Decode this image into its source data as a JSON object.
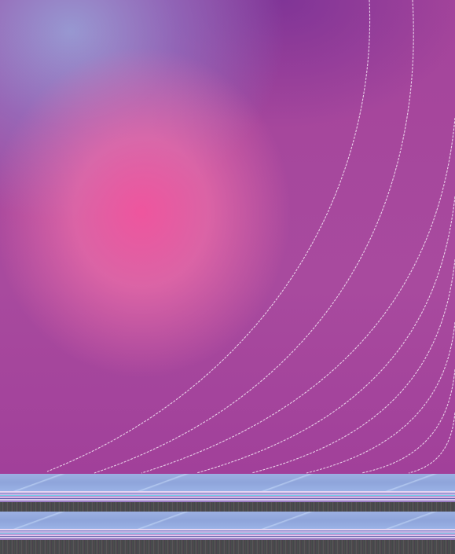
{
  "screen": {
    "kind": "desktop-wallpaper",
    "palette": {
      "base": "#a6449a",
      "glow_pink": "#f2569e",
      "glow_lavender": "#96a0d7",
      "deep_purple": "#7a3296",
      "arc_line": "#f4e6f4",
      "strip_blue": "#8ea4da",
      "strip_noise": "#454a48"
    }
  },
  "wallpaper": {
    "icon": "abstract-gradient-wallpaper",
    "arc_count": 8
  },
  "glitch_strips": {
    "count": 2,
    "icon": "corrupted-scanline-strip"
  }
}
